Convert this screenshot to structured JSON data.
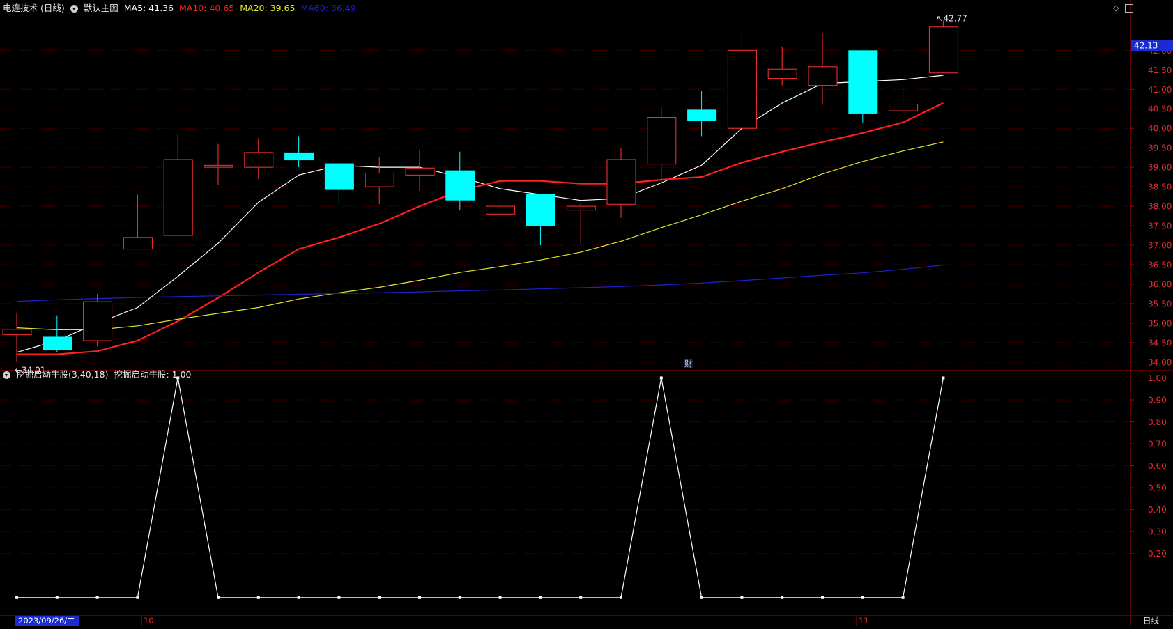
{
  "header": {
    "stock": "电连技术 (日线)",
    "template": "默认主图",
    "ma5": {
      "label": "MA5: 41.36",
      "color": "#ffffff"
    },
    "ma10": {
      "label": "MA10: 40.65",
      "color": "#ff2020"
    },
    "ma20": {
      "label": "MA20: 39.65",
      "color": "#e6e62e"
    },
    "ma60": {
      "label": "MA60: 36.49",
      "color": "#2222cc"
    }
  },
  "indicator_header": {
    "name": "挖掘启动牛股(3,40,18)",
    "value": "挖掘启动牛股: 1.00"
  },
  "window_icons": [
    "diamond-icon",
    "restore-icon"
  ],
  "fin_marker": "财",
  "last_price": "42.13",
  "annotations": {
    "high": "42.77",
    "low": "34.01"
  },
  "time_axis": {
    "start": "2023/09/26/二",
    "months": [
      "10",
      "11"
    ]
  },
  "period": "日线",
  "colors": {
    "up": "#ff3232",
    "down": "#00ffff",
    "axis": "#b00000",
    "grid": "#5a0000",
    "tick_text": "#e03030",
    "price_box": "#1a2bd0"
  },
  "chart_data": [
    {
      "type": "candlestick",
      "yaxis": {
        "min": 34.0,
        "max": 42.0,
        "step": 0.5,
        "range": [
          33.8,
          42.9
        ],
        "ticks": [
          "34.00",
          "34.50",
          "35.00",
          "35.50",
          "36.00",
          "36.50",
          "37.00",
          "37.50",
          "38.00",
          "38.50",
          "39.00",
          "39.50",
          "40.00",
          "40.50",
          "41.00",
          "41.50",
          "42.00"
        ]
      },
      "candles": [
        {
          "o": 34.7,
          "h": 35.27,
          "l": 34.01,
          "c": 34.84
        },
        {
          "o": 34.65,
          "h": 35.2,
          "l": 34.25,
          "c": 34.3
        },
        {
          "o": 34.55,
          "h": 35.75,
          "l": 34.4,
          "c": 35.55
        },
        {
          "o": 36.9,
          "h": 38.3,
          "l": 36.9,
          "c": 37.2
        },
        {
          "o": 37.25,
          "h": 39.85,
          "l": 37.25,
          "c": 39.2
        },
        {
          "o": 39.0,
          "h": 39.6,
          "l": 38.55,
          "c": 39.05
        },
        {
          "o": 39.0,
          "h": 39.75,
          "l": 38.7,
          "c": 39.38
        },
        {
          "o": 39.38,
          "h": 39.8,
          "l": 39.0,
          "c": 39.18
        },
        {
          "o": 39.1,
          "h": 39.15,
          "l": 38.05,
          "c": 38.42
        },
        {
          "o": 38.5,
          "h": 39.25,
          "l": 38.05,
          "c": 38.85
        },
        {
          "o": 38.8,
          "h": 39.45,
          "l": 38.4,
          "c": 38.98
        },
        {
          "o": 38.92,
          "h": 39.4,
          "l": 37.9,
          "c": 38.15
        },
        {
          "o": 37.8,
          "h": 38.25,
          "l": 37.8,
          "c": 38.0
        },
        {
          "o": 38.32,
          "h": 38.32,
          "l": 37.0,
          "c": 37.5
        },
        {
          "o": 37.9,
          "h": 38.1,
          "l": 37.05,
          "c": 38.0
        },
        {
          "o": 38.05,
          "h": 39.5,
          "l": 37.7,
          "c": 39.2
        },
        {
          "o": 39.08,
          "h": 40.55,
          "l": 38.6,
          "c": 40.28
        },
        {
          "o": 40.48,
          "h": 40.95,
          "l": 39.8,
          "c": 40.2
        },
        {
          "o": 40.0,
          "h": 42.55,
          "l": 40.0,
          "c": 42.0
        },
        {
          "o": 41.28,
          "h": 42.1,
          "l": 41.1,
          "c": 41.52
        },
        {
          "o": 41.1,
          "h": 42.45,
          "l": 40.6,
          "c": 41.58
        },
        {
          "o": 42.0,
          "h": 42.0,
          "l": 40.15,
          "c": 40.38
        },
        {
          "o": 40.45,
          "h": 41.1,
          "l": 40.45,
          "c": 40.62
        },
        {
          "o": 41.42,
          "h": 42.77,
          "l": 41.42,
          "c": 42.6
        }
      ],
      "series": [
        {
          "name": "MA5",
          "color": "#ffffff",
          "width": 1.2,
          "values": [
            34.25,
            34.55,
            35.0,
            35.4,
            36.2,
            37.05,
            38.1,
            38.8,
            39.05,
            39.0,
            39.0,
            38.75,
            38.45,
            38.3,
            38.15,
            38.2,
            38.6,
            39.05,
            40.0,
            40.65,
            41.15,
            41.2,
            41.25,
            41.36
          ]
        },
        {
          "name": "MA10",
          "color": "#ff2020",
          "width": 2.2,
          "values": [
            34.2,
            34.2,
            34.28,
            34.55,
            35.05,
            35.65,
            36.3,
            36.9,
            37.2,
            37.55,
            38.0,
            38.4,
            38.65,
            38.65,
            38.58,
            38.58,
            38.68,
            38.75,
            39.12,
            39.4,
            39.65,
            39.88,
            40.15,
            40.65
          ]
        },
        {
          "name": "MA20",
          "color": "#e6e62e",
          "width": 1.2,
          "values": [
            34.88,
            34.83,
            34.83,
            34.93,
            35.1,
            35.25,
            35.4,
            35.62,
            35.78,
            35.92,
            36.1,
            36.3,
            36.45,
            36.62,
            36.82,
            37.1,
            37.45,
            37.78,
            38.13,
            38.45,
            38.83,
            39.15,
            39.42,
            39.65
          ]
        },
        {
          "name": "MA60",
          "color": "#2222cc",
          "width": 1.2,
          "values": [
            35.56,
            35.6,
            35.63,
            35.66,
            35.68,
            35.7,
            35.72,
            35.74,
            35.76,
            35.78,
            35.8,
            35.83,
            35.85,
            35.88,
            35.91,
            35.94,
            35.98,
            36.03,
            36.09,
            36.16,
            36.23,
            36.29,
            36.38,
            36.49
          ]
        }
      ]
    },
    {
      "type": "line",
      "name": "挖掘启动牛股",
      "yaxis": {
        "range": [
          -0.08,
          1.03
        ],
        "ticks": [
          "0.20",
          "0.30",
          "0.40",
          "0.50",
          "0.60",
          "0.70",
          "0.80",
          "0.90",
          "1.00"
        ],
        "tick_values": [
          0.2,
          0.3,
          0.4,
          0.5,
          0.6,
          0.7,
          0.8,
          0.9,
          1.0
        ]
      },
      "values": [
        0,
        0,
        0,
        0,
        1,
        0,
        0,
        0,
        0,
        0,
        0,
        0,
        0,
        0,
        0,
        0,
        1,
        0,
        0,
        0,
        0,
        0,
        0,
        1
      ]
    }
  ]
}
